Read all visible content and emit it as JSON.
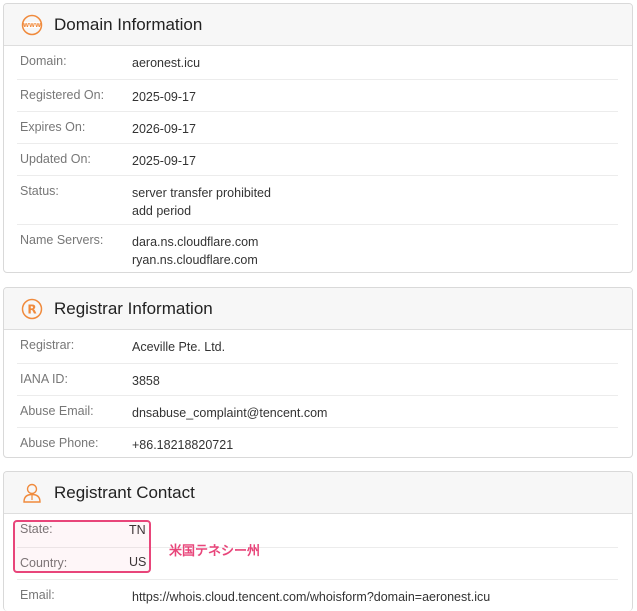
{
  "domain_info": {
    "title": "Domain Information",
    "icon": "www-globe-icon",
    "domain_label": "Domain:",
    "domain_value": "aeronest.icu",
    "registered_label": "Registered On:",
    "registered_value": "2025-09-17",
    "expires_label": "Expires On:",
    "expires_value": "2026-09-17",
    "updated_label": "Updated On:",
    "updated_value": "2025-09-17",
    "status_label": "Status:",
    "status_values": [
      "server transfer prohibited",
      "add period"
    ],
    "ns_label": "Name Servers:",
    "ns_values": [
      "dara.ns.cloudflare.com",
      "ryan.ns.cloudflare.com"
    ]
  },
  "registrar_info": {
    "title": "Registrar Information",
    "icon": "registered-icon",
    "registrar_label": "Registrar:",
    "registrar_value": "Aceville Pte. Ltd.",
    "iana_label": "IANA ID:",
    "iana_value": "3858",
    "abuse_email_label": "Abuse Email:",
    "abuse_email_value": "dnsabuse_complaint@tencent.com",
    "abuse_phone_label": "Abuse Phone:",
    "abuse_phone_value": "+86.18218820721"
  },
  "registrant_contact": {
    "title": "Registrant Contact",
    "icon": "person-icon",
    "state_label": "State:",
    "state_value": "TN",
    "country_label": "Country:",
    "country_value": "US",
    "email_label": "Email:",
    "email_value": "https://whois.cloud.tencent.com/whoisform?domain=aeronest.icu"
  },
  "annotation": {
    "text": "米国テネシー州"
  },
  "colors": {
    "accent": "#f08a3c",
    "highlight": "#e8457a",
    "header_bg": "#f7f7f7",
    "label": "#777777"
  }
}
